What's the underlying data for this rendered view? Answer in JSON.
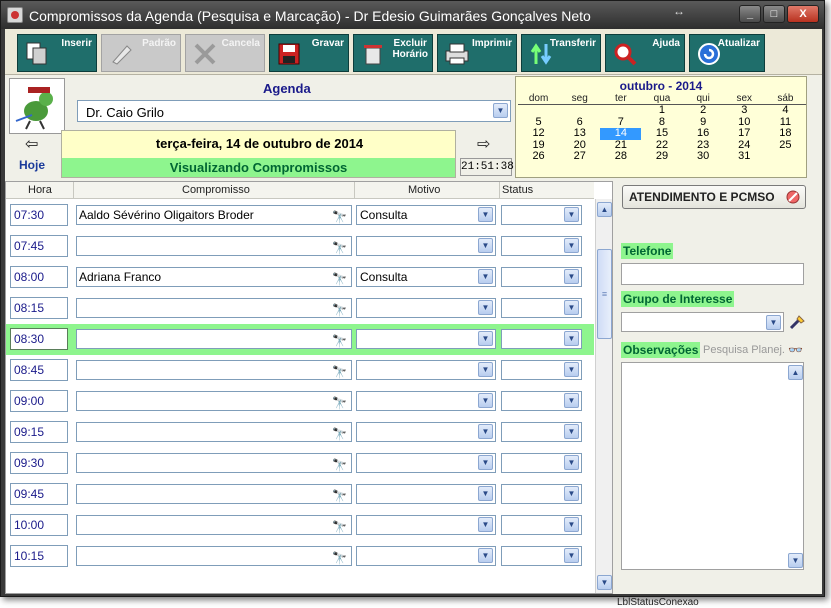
{
  "window": {
    "title": "Compromissos da Agenda (Pesquisa e Marcação) - Dr Edesio Guimarães Gonçalves Neto",
    "resize_glyph": "↔",
    "minimize": "_",
    "maximize": "□",
    "close": "X"
  },
  "toolbar": {
    "inserir": "Inserir",
    "padrao": "Padrão",
    "cancela": "Cancela",
    "gravar": "Gravar",
    "excluir_l1": "Excluir",
    "excluir_l2": "Horário",
    "imprimir": "Imprimir",
    "transferir": "Transferir",
    "ajuda": "Ajuda",
    "atualizar": "Atualizar"
  },
  "agenda": {
    "label": "Agenda",
    "doctor": "Dr. Caio Grilo",
    "date": "terça-feira, 14 de outubro de 2014",
    "mode": "Visualizando Compromissos",
    "today": "Hoje",
    "clock": "21:51:38",
    "prev": "⇦",
    "next": "⇨"
  },
  "calendar": {
    "title": "outubro - 2014",
    "weekdays": [
      "dom",
      "seg",
      "ter",
      "qua",
      "qui",
      "sex",
      "sáb"
    ],
    "weeks": [
      [
        "",
        "",
        "",
        "1",
        "2",
        "3",
        "4"
      ],
      [
        "5",
        "6",
        "7",
        "8",
        "9",
        "10",
        "11"
      ],
      [
        "12",
        "13",
        "14",
        "15",
        "16",
        "17",
        "18"
      ],
      [
        "19",
        "20",
        "21",
        "22",
        "23",
        "24",
        "25"
      ],
      [
        "26",
        "27",
        "28",
        "29",
        "30",
        "31",
        ""
      ]
    ],
    "selected": "14"
  },
  "grid": {
    "headers": {
      "hora": "Hora",
      "compromisso": "Compromisso",
      "motivo": "Motivo",
      "status": "Status"
    },
    "rows": [
      {
        "time": "07:30",
        "name": "Aaldo Sévérino Oligaitors Broder",
        "motivo": "Consulta"
      },
      {
        "time": "07:45",
        "name": "",
        "motivo": ""
      },
      {
        "time": "08:00",
        "name": "Adriana Franco",
        "motivo": "Consulta"
      },
      {
        "time": "08:15",
        "name": "",
        "motivo": ""
      },
      {
        "time": "08:30",
        "name": "",
        "motivo": ""
      },
      {
        "time": "08:45",
        "name": "",
        "motivo": ""
      },
      {
        "time": "09:00",
        "name": "",
        "motivo": ""
      },
      {
        "time": "09:15",
        "name": "",
        "motivo": ""
      },
      {
        "time": "09:30",
        "name": "",
        "motivo": ""
      },
      {
        "time": "09:45",
        "name": "",
        "motivo": ""
      },
      {
        "time": "10:00",
        "name": "",
        "motivo": ""
      },
      {
        "time": "10:15",
        "name": "",
        "motivo": ""
      }
    ],
    "active_time": "08:30"
  },
  "right_panel": {
    "atendimento": "ATENDIMENTO E PCMSO",
    "telefone": "Telefone",
    "grupo": "Grupo de Interesse",
    "observacoes": "Observações",
    "pesquisa": "Pesquisa Planej.",
    "status_label": "LblStatusConexao"
  },
  "colors": {
    "toolbar_button": "#1f6e6b",
    "highlight_green": "#8ef58e",
    "date_panel": "#ffffc8",
    "selected_day": "#3399ff"
  }
}
